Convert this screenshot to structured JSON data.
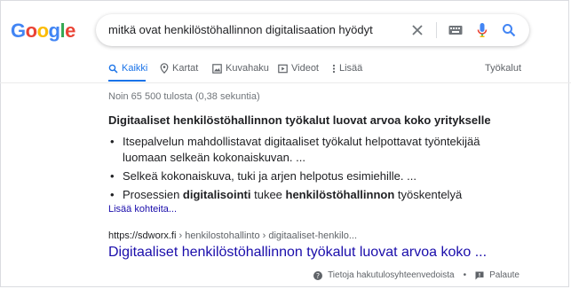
{
  "logo": {
    "letters": [
      "G",
      "o",
      "o",
      "g",
      "l",
      "e"
    ],
    "colors": [
      "#4285F4",
      "#EA4335",
      "#FBBC05",
      "#4285F4",
      "#34A853",
      "#EA4335"
    ]
  },
  "search": {
    "query": "mitkä ovat henkilöstöhallinnon digitalisaation hyödyt"
  },
  "tabs": [
    {
      "label": "Kaikki",
      "icon": "search-icon"
    },
    {
      "label": "Kartat",
      "icon": "map-pin-icon"
    },
    {
      "label": "Kuvahaku",
      "icon": "image-icon"
    },
    {
      "label": "Videot",
      "icon": "video-icon"
    },
    {
      "label": "Lisää",
      "icon": "more-vert-icon"
    }
  ],
  "tools_label": "Työkalut",
  "stats": "Noin 65 500 tulosta (0,38 sekuntia)",
  "snippet": {
    "title": "Digitaaliset henkilöstöhallinnon työkalut luovat arvoa koko yritykselle",
    "bullets": [
      {
        "text": "Itsepalvelun mahdollistavat digitaaliset työkalut helpottavat työntekijää luomaan selkeän kokonaiskuvan. ..."
      },
      {
        "text": "Selkeä kokonaiskuva, tuki ja arjen helpotus esimiehille. ..."
      },
      {
        "pre": "Prosessien ",
        "b1": "digitalisointi",
        "mid": " tukee ",
        "b2": "henkilöstöhallinnon",
        "post": " työskentelyä"
      }
    ],
    "more": "Lisää kohteita..."
  },
  "result": {
    "cite_domain": "https://sdworx.fi",
    "cite_path": " › henkilostohallinto › digitaaliset-henkilo...",
    "title": "Digitaaliset henkilöstöhallinnon työkalut luovat arvoa koko ..."
  },
  "footer": {
    "about": "Tietoja hakutulosyhteenvedoista",
    "feedback": "Palaute"
  }
}
